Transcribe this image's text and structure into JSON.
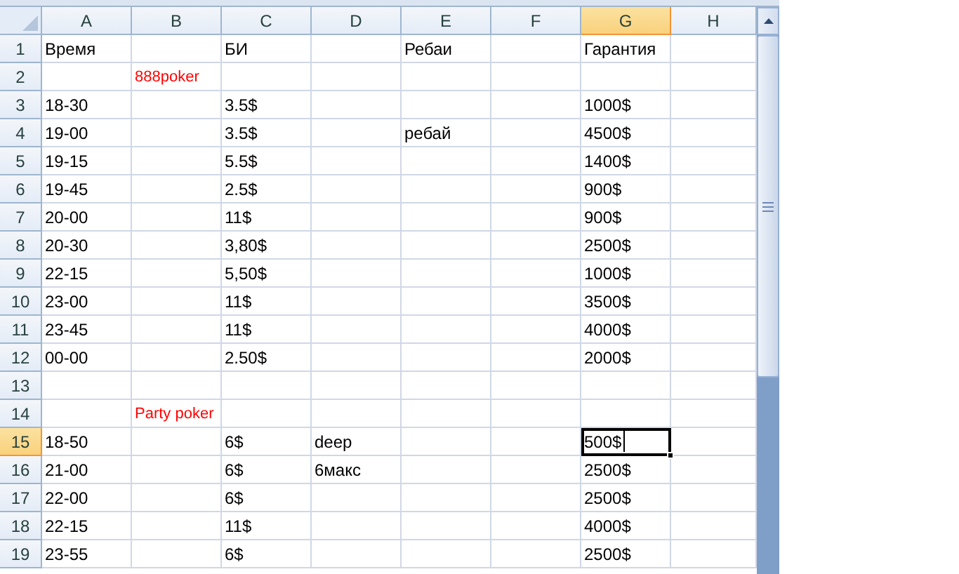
{
  "columns": [
    {
      "label": "A",
      "selected": false
    },
    {
      "label": "B",
      "selected": false
    },
    {
      "label": "C",
      "selected": false
    },
    {
      "label": "D",
      "selected": false
    },
    {
      "label": "E",
      "selected": false
    },
    {
      "label": "F",
      "selected": false
    },
    {
      "label": "G",
      "selected": true
    },
    {
      "label": "H",
      "selected": false
    }
  ],
  "rows": [
    {
      "number": "1",
      "selected": false,
      "cells": {
        "A": {
          "text": "Время",
          "selected": false
        },
        "C": {
          "text": "БИ",
          "selected": false
        },
        "E": {
          "text": "Ребаи",
          "selected": false
        },
        "G": {
          "text": "Гарантия",
          "selected": false
        }
      }
    },
    {
      "number": "2",
      "selected": false,
      "cells": {
        "B": {
          "text": "888poker",
          "selected": false,
          "color": "#ff0000"
        }
      }
    },
    {
      "number": "3",
      "selected": false,
      "cells": {
        "A": {
          "text": "18-30",
          "selected": false
        },
        "C": {
          "text": "3.5$",
          "selected": false
        },
        "G": {
          "text": "1000$",
          "selected": false
        }
      }
    },
    {
      "number": "4",
      "selected": false,
      "cells": {
        "A": {
          "text": "19-00",
          "selected": false
        },
        "C": {
          "text": "3.5$",
          "selected": false
        },
        "E": {
          "text": "ребай",
          "selected": false
        },
        "G": {
          "text": "4500$",
          "selected": false
        }
      }
    },
    {
      "number": "5",
      "selected": false,
      "cells": {
        "A": {
          "text": "19-15",
          "selected": false
        },
        "C": {
          "text": "5.5$",
          "selected": false
        },
        "G": {
          "text": "1400$",
          "selected": false
        }
      }
    },
    {
      "number": "6",
      "selected": false,
      "cells": {
        "A": {
          "text": "19-45",
          "selected": false
        },
        "C": {
          "text": "2.5$",
          "selected": false
        },
        "G": {
          "text": "900$",
          "selected": false
        }
      }
    },
    {
      "number": "7",
      "selected": false,
      "cells": {
        "A": {
          "text": "20-00",
          "selected": false
        },
        "C": {
          "text": "11$",
          "selected": false
        },
        "G": {
          "text": "900$",
          "selected": false
        }
      }
    },
    {
      "number": "8",
      "selected": false,
      "cells": {
        "A": {
          "text": "20-30",
          "selected": false
        },
        "C": {
          "text": "3,80$",
          "selected": false
        },
        "G": {
          "text": "2500$",
          "selected": false
        }
      }
    },
    {
      "number": "9",
      "selected": false,
      "cells": {
        "A": {
          "text": "22-15",
          "selected": false
        },
        "C": {
          "text": "5,50$",
          "selected": false
        },
        "G": {
          "text": "1000$",
          "selected": false
        }
      }
    },
    {
      "number": "10",
      "selected": false,
      "cells": {
        "A": {
          "text": "23-00",
          "selected": false
        },
        "C": {
          "text": "11$",
          "selected": false
        },
        "G": {
          "text": "3500$",
          "selected": false
        }
      }
    },
    {
      "number": "11",
      "selected": false,
      "cells": {
        "A": {
          "text": "23-45",
          "selected": false
        },
        "C": {
          "text": "11$",
          "selected": false
        },
        "G": {
          "text": "4000$",
          "selected": false
        }
      }
    },
    {
      "number": "12",
      "selected": false,
      "cells": {
        "A": {
          "text": "00-00",
          "selected": false
        },
        "C": {
          "text": "2.50$",
          "selected": false
        },
        "G": {
          "text": "2000$",
          "selected": false
        }
      }
    },
    {
      "number": "13",
      "selected": false
    },
    {
      "number": "14",
      "selected": false,
      "cells": {
        "B": {
          "text": "Party poker",
          "selected": false,
          "color": "#ff0000"
        }
      }
    },
    {
      "number": "15",
      "selected": true,
      "cells": {
        "A": {
          "text": "18-50",
          "selected": false
        },
        "C": {
          "text": "6$",
          "selected": false
        },
        "D": {
          "text": "deep",
          "selected": false
        },
        "G": {
          "text": "500$",
          "selected": true
        }
      }
    },
    {
      "number": "16",
      "selected": false,
      "cells": {
        "A": {
          "text": "21-00",
          "selected": false
        },
        "C": {
          "text": "6$",
          "selected": false
        },
        "D": {
          "text": "6макс",
          "selected": false
        },
        "G": {
          "text": "2500$",
          "selected": false
        }
      }
    },
    {
      "number": "17",
      "selected": false,
      "cells": {
        "A": {
          "text": "22-00",
          "selected": false
        },
        "C": {
          "text": "6$",
          "selected": false
        },
        "G": {
          "text": "2500$",
          "selected": false
        }
      }
    },
    {
      "number": "18",
      "selected": false,
      "cells": {
        "A": {
          "text": "22-15",
          "selected": false
        },
        "C": {
          "text": "11$",
          "selected": false
        },
        "G": {
          "text": "4000$",
          "selected": false
        }
      }
    },
    {
      "number": "19",
      "selected": false,
      "cells": {
        "A": {
          "text": "23-55",
          "selected": false
        },
        "C": {
          "text": "6$",
          "selected": false
        },
        "G": {
          "text": "2500$",
          "selected": false
        }
      }
    }
  ]
}
